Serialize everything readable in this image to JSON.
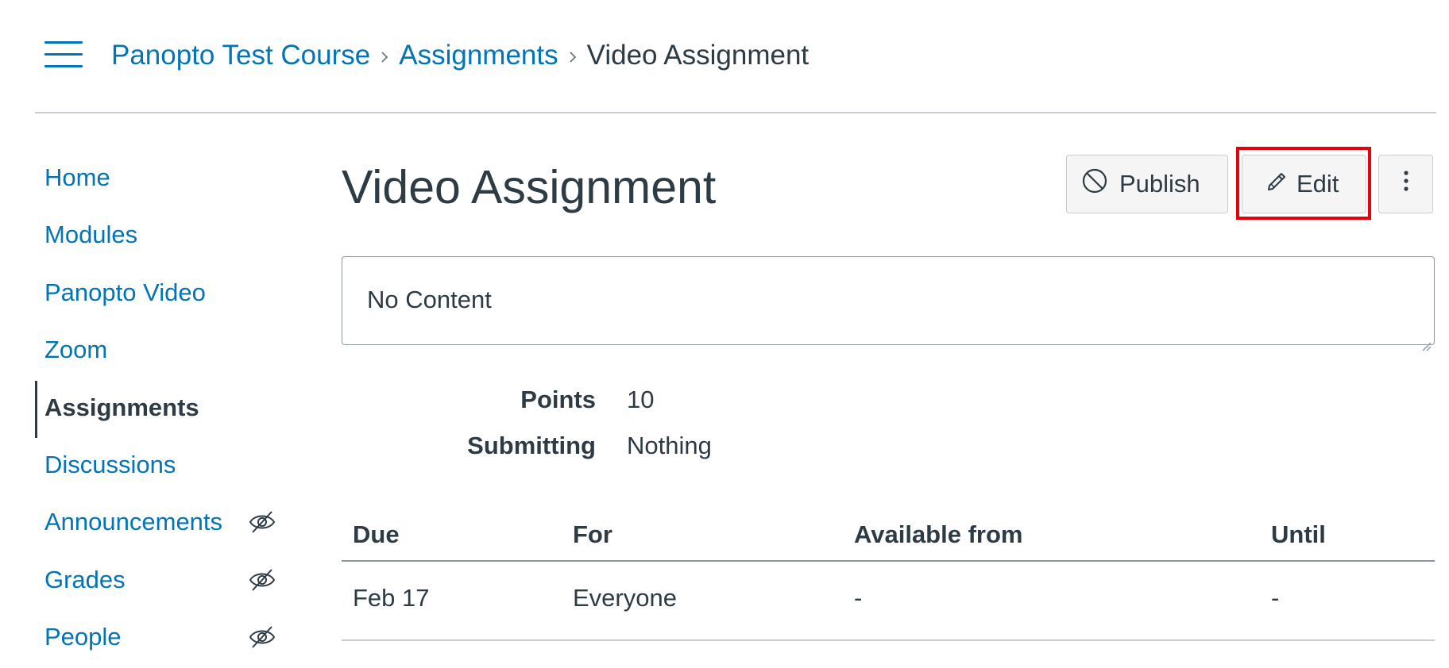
{
  "breadcrumb": {
    "items": [
      {
        "label": "Panopto Test Course"
      },
      {
        "label": "Assignments"
      },
      {
        "label": "Video Assignment"
      }
    ],
    "menu_icon": "hamburger-menu-icon",
    "separator_icon": "chevron-right-icon"
  },
  "sidebar": {
    "items": [
      {
        "label": "Home"
      },
      {
        "label": "Modules"
      },
      {
        "label": "Panopto Video"
      },
      {
        "label": "Zoom"
      },
      {
        "label": "Assignments"
      },
      {
        "label": "Discussions"
      },
      {
        "label": "Announcements"
      },
      {
        "label": "Grades"
      },
      {
        "label": "People"
      }
    ],
    "active_item": "Assignments",
    "hidden_icon": "eye-slash-icon"
  },
  "main": {
    "title": "Video Assignment",
    "buttons": {
      "publish_label": "Publish",
      "publish_icon": "unpublished-icon",
      "edit_label": "Edit",
      "edit_icon": "pencil-icon",
      "more_icon": "vertical-ellipsis-icon"
    },
    "content": "No Content",
    "details": [
      {
        "label": "Points",
        "value": "10"
      },
      {
        "label": "Submitting",
        "value": "Nothing"
      }
    ],
    "dates": {
      "headers": [
        "Due",
        "For",
        "Available from",
        "Until"
      ],
      "rows": [
        [
          "Feb 17",
          "Everyone",
          "-",
          "-"
        ]
      ]
    }
  },
  "colors": {
    "link": "#0374b5",
    "text": "#2d3b45",
    "highlight": "#e8000b",
    "button_bg": "#f5f5f5",
    "border": "#c7cdd1"
  }
}
